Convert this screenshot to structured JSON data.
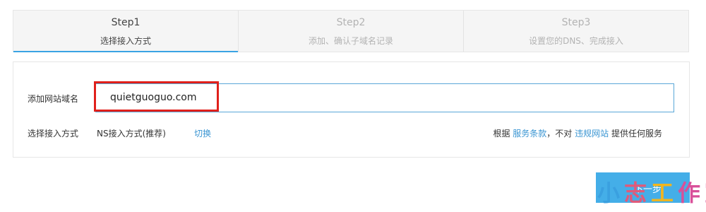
{
  "steps": [
    {
      "num": "Step1",
      "desc": "选择接入方式",
      "active": true
    },
    {
      "num": "Step2",
      "desc": "添加、确认子域名记录",
      "active": false
    },
    {
      "num": "Step3",
      "desc": "设置您的DNS、完成接入",
      "active": false
    }
  ],
  "form": {
    "domain_label": "添加网站域名",
    "domain_value": "quietguoguo.com",
    "method_label": "选择接入方式",
    "method_value": "NS接入方式(推荐)",
    "switch_label": "切换"
  },
  "terms": {
    "prefix": "根据",
    "link1": "服务条款",
    "middle": "，不对",
    "link2": "违规网站",
    "suffix": "提供任何服务"
  },
  "next_button": {
    "label": "下一步"
  },
  "watermark": {
    "c1": "小",
    "c2": "志",
    "c3": "工",
    "c4": "作",
    "c5": "室"
  },
  "colors": {
    "accent": "#3aa3e3",
    "highlight": "#e0201b",
    "button": "#44aee8"
  }
}
